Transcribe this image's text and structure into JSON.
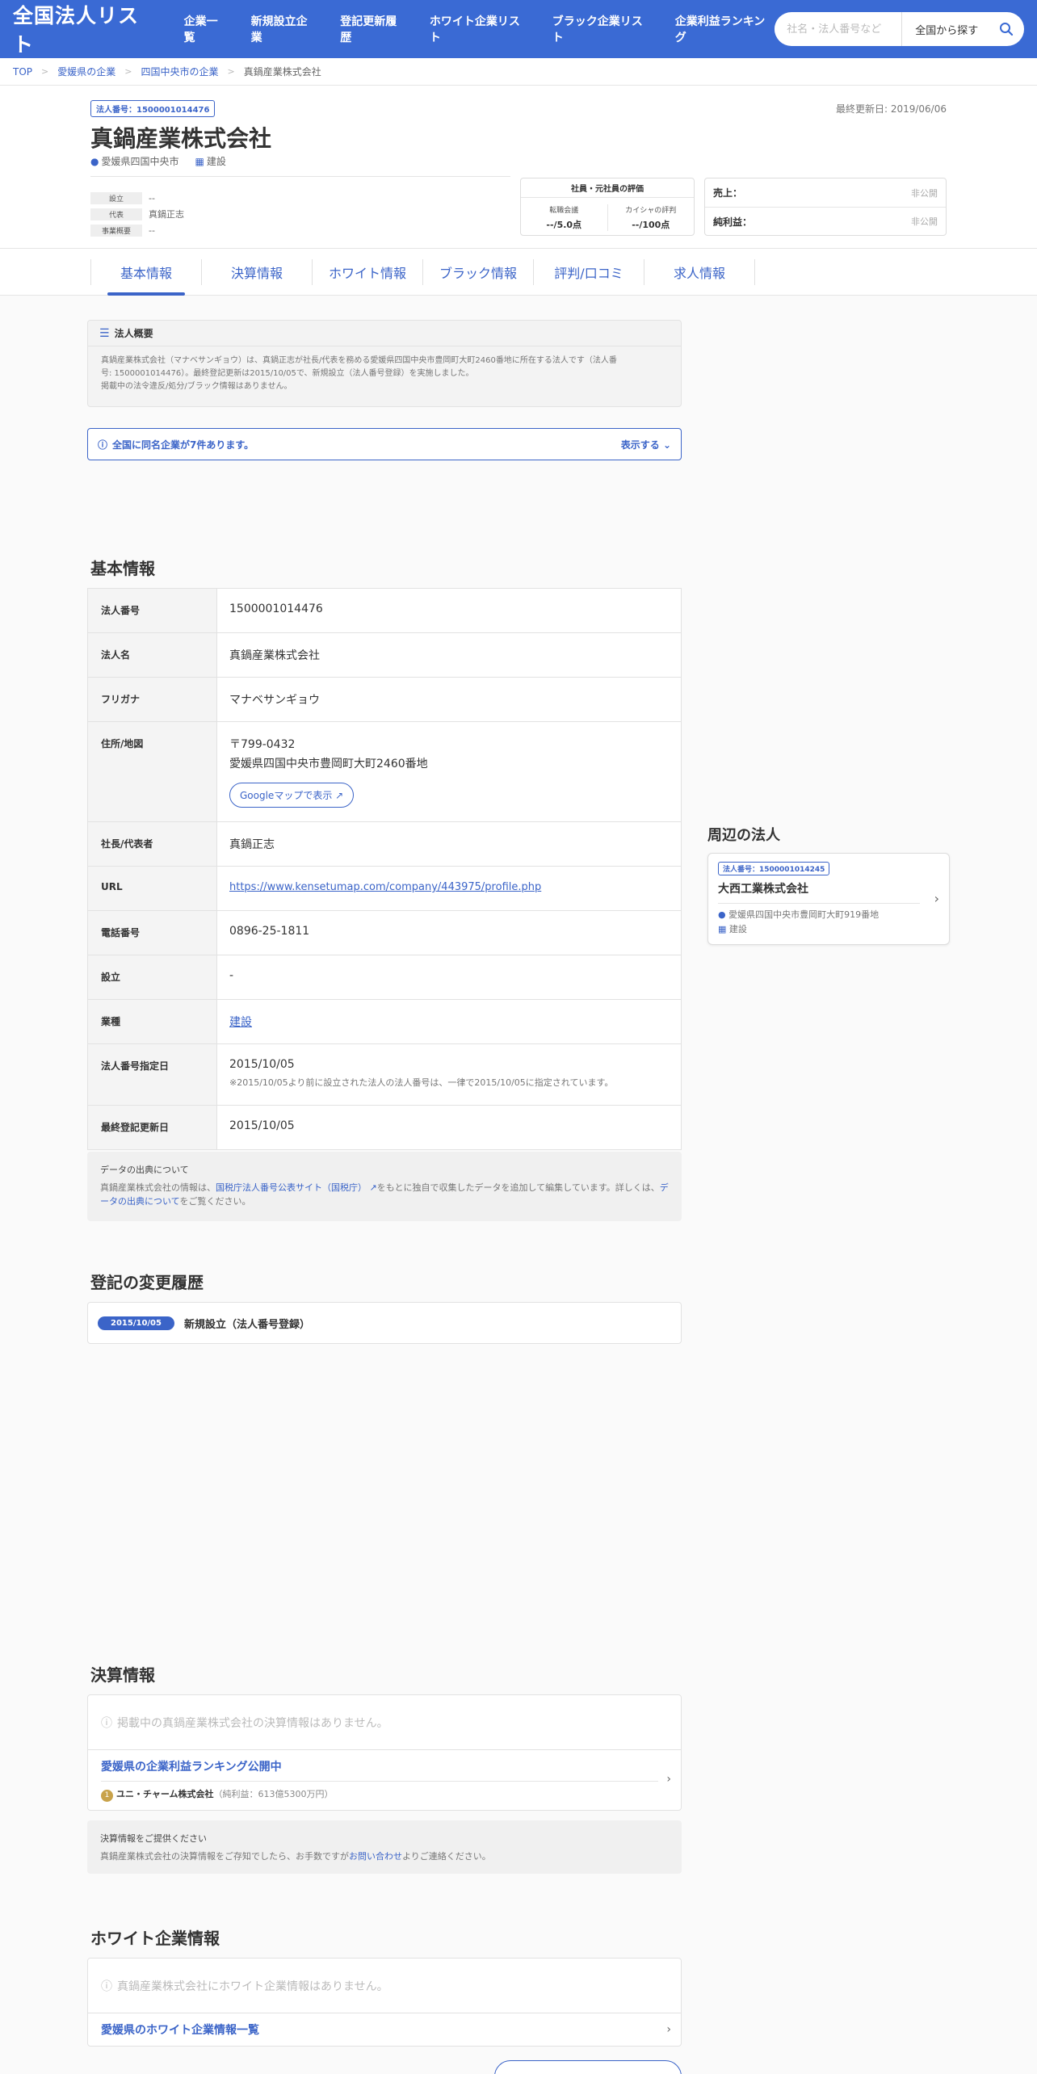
{
  "header": {
    "logo": "全国法人リスト",
    "nav": [
      "企業一覧",
      "新規設立企業",
      "登記更新履歴",
      "ホワイト企業リスト",
      "ブラック企業リスト",
      "企業利益ランキング"
    ],
    "search_placeholder": "社名・法人番号など",
    "search_scope": "全国から探す"
  },
  "breadcrumb": [
    "TOP",
    "愛媛県の企業",
    "四国中央市の企業",
    "真鍋産業株式会社"
  ],
  "company": {
    "corp_number_badge": "法人番号：1500001014476",
    "last_updated": "最終更新日: 2019/06/06",
    "name": "真鍋産業株式会社",
    "location": "愛媛県四国中央市",
    "industry": "建設",
    "mini": [
      {
        "k": "設立",
        "v": "--"
      },
      {
        "k": "代表",
        "v": "真鍋正志"
      },
      {
        "k": "事業概要",
        "v": "--"
      }
    ],
    "eval": {
      "title": "社員・元社員の評価",
      "items": [
        {
          "label": "転職会議",
          "value": "--/5.0点"
        },
        {
          "label": "カイシャの評判",
          "value": "--/100点"
        }
      ]
    },
    "fin": [
      {
        "k": "売上：",
        "v": "非公開"
      },
      {
        "k": "純利益：",
        "v": "非公開"
      }
    ]
  },
  "tabs": [
    "基本情報",
    "決算情報",
    "ホワイト情報",
    "ブラック情報",
    "評判/口コミ",
    "求人情報"
  ],
  "overview": {
    "title": "法人概要",
    "lines": [
      "真鍋産業株式会社（マナベサンギョウ）は、真鍋正志が社長/代表を務める愛媛県四国中央市豊岡町大町2460番地に所在する法人です（法人番",
      "号: 1500001014476）。最終登記更新は2015/10/05で、新規設立（法人番号登録）を実施しました。",
      "掲載中の法令違反/処分/ブラック情報はありません。"
    ]
  },
  "same_name": {
    "text": "全国に同名企業が7件あります。",
    "toggle": "表示する"
  },
  "basic": {
    "title": "基本情報",
    "rows": [
      {
        "k": "法人番号",
        "v": "1500001014476"
      },
      {
        "k": "法人名",
        "v": "真鍋産業株式会社"
      },
      {
        "k": "フリガナ",
        "v": "マナベサンギョウ"
      },
      {
        "k": "住所/地図",
        "v": "〒799-0432",
        "v2": "愛媛県四国中央市豊岡町大町2460番地",
        "btn": "Googleマップで表示"
      },
      {
        "k": "社長/代表者",
        "v": "真鍋正志"
      },
      {
        "k": "URL",
        "v": "https://www.kensetumap.com/company/443975/profile.php"
      },
      {
        "k": "電話番号",
        "v": "0896-25-1811"
      },
      {
        "k": "設立",
        "v": "-"
      },
      {
        "k": "業種",
        "v": "建設"
      },
      {
        "k": "法人番号指定日",
        "v": "2015/10/05",
        "note": "※2015/10/05より前に設立された法人の法人番号は、一律で2015/10/05に指定されています。"
      },
      {
        "k": "最終登記更新日",
        "v": "2015/10/05"
      }
    ]
  },
  "source": {
    "title": "データの出典について",
    "pre": "真鍋産業株式会社の情報は、",
    "link1": "国税庁法人番号公表サイト（国税庁）",
    "mid": "をもとに独自で収集したデータを追加して編集しています。詳しくは、",
    "link2": "データの出典について",
    "post": "をご覧ください。"
  },
  "history": {
    "title": "登記の変更履歴",
    "date": "2015/10/05",
    "text": "新規設立（法人番号登録）"
  },
  "nearby": {
    "title": "周辺の法人",
    "no": "法人番号：1500001014245",
    "name": "大西工業株式会社",
    "address": "愛媛県四国中央市豊岡町大町919番地",
    "industry": "建設"
  },
  "finance": {
    "title": "決算情報",
    "empty": "掲載中の真鍋産業株式会社の決算情報はありません。",
    "link": "愛媛県の企業利益ランキング公開中",
    "rank_no": "1",
    "rank_name": "ユニ・チャーム株式会社",
    "rank_profit": "（純利益：613億5300万円）",
    "ask_title": "決算情報をご提供ください",
    "ask_pre": "真鍋産業株式会社の決算情報をご存知でしたら、お手数ですが",
    "ask_link": "お問い合わせ",
    "ask_post": "よりご連絡ください。"
  },
  "white": {
    "title": "ホワイト企業情報",
    "empty": "真鍋産業株式会社にホワイト企業情報はありません。",
    "link": "愛媛県のホワイト企業情報一覧"
  }
}
